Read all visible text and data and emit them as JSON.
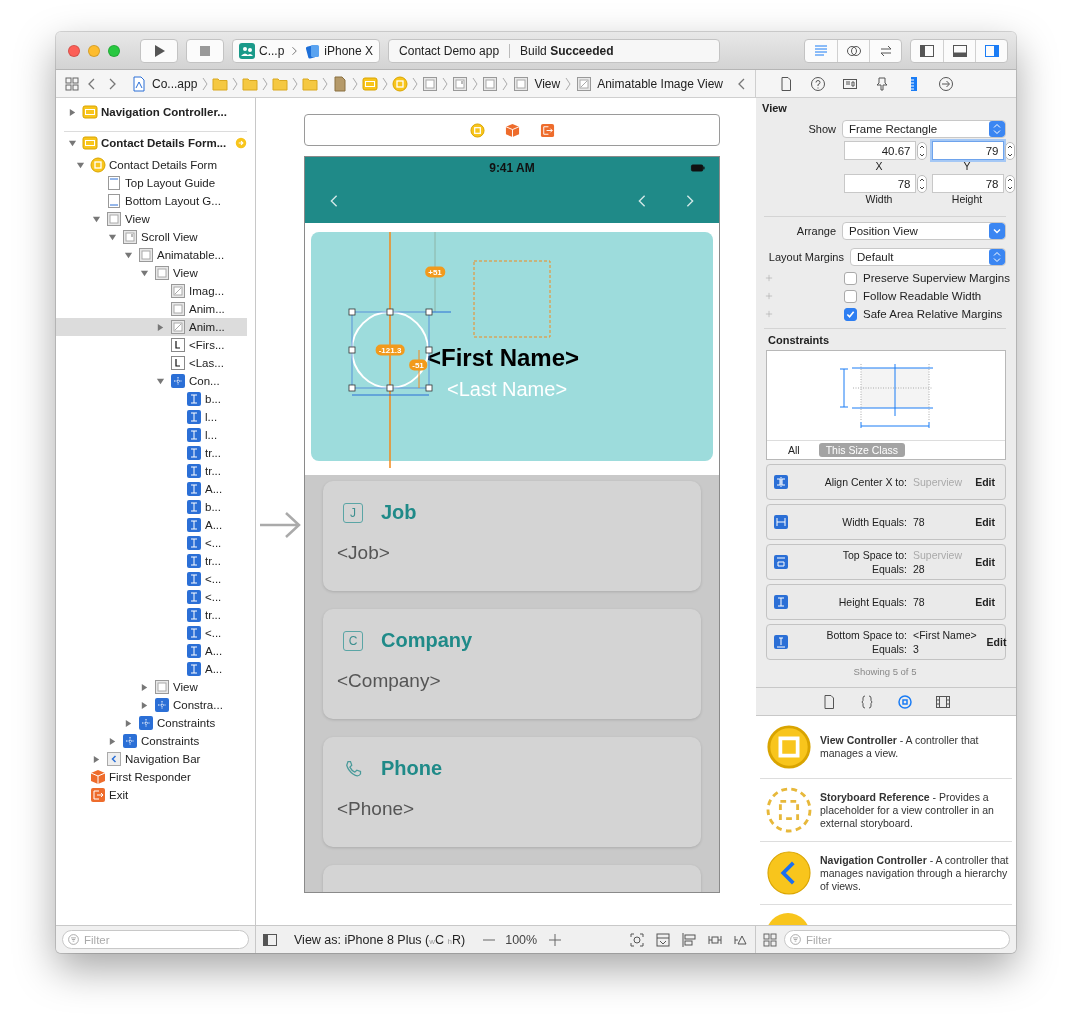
{
  "toolbar": {
    "scheme": {
      "target": "C...p",
      "destination": "iPhone X"
    },
    "activity": {
      "project": "Contact Demo app",
      "status": "Build **Succeeded**"
    },
    "editor_modes": [
      {
        "kind": "editor-standard",
        "selected": true
      },
      {
        "kind": "editor-assistant",
        "selected": false
      },
      {
        "kind": "editor-version",
        "selected": false
      }
    ],
    "panels": [
      {
        "kind": "panel-left",
        "on": false
      },
      {
        "kind": "panel-bottom",
        "on": false
      },
      {
        "kind": "panel-right",
        "on": true
      }
    ]
  },
  "jump_bar": {
    "crumbs": [
      {
        "kind": "project-file",
        "label": "Co...app"
      },
      {
        "kind": "folder"
      },
      {
        "kind": "folder"
      },
      {
        "kind": "folder"
      },
      {
        "kind": "folder"
      },
      {
        "kind": "storyboard-file"
      },
      {
        "kind": "scene"
      },
      {
        "kind": "view-controller"
      },
      {
        "kind": "view"
      },
      {
        "kind": "scroll"
      },
      {
        "kind": "view"
      },
      {
        "kind": "view",
        "label": "View"
      },
      {
        "kind": "image",
        "label": "Animatable Image View"
      }
    ]
  },
  "navigator": {
    "tree": [
      {
        "label": "Navigation Controller...",
        "kind": "scene",
        "expanded": false,
        "selected": false,
        "initial": false
      },
      {
        "label": "Contact Details Form...",
        "kind": "scene",
        "expanded": true,
        "selected": false,
        "initial": true,
        "children": [
          {
            "label": "Contact Details Form",
            "kind": "view-controller",
            "expanded": true,
            "selected": false,
            "children": [
              {
                "label": "Top Layout Guide",
                "kind": "guide-top",
                "selected": false
              },
              {
                "label": "Bottom Layout G...",
                "kind": "guide-bottom",
                "selected": false
              },
              {
                "label": "View",
                "kind": "view",
                "expanded": true,
                "selected": false,
                "children": [
                  {
                    "label": "Scroll View",
                    "kind": "scroll",
                    "expanded": true,
                    "selected": false,
                    "children": [
                      {
                        "label": "Animatable...",
                        "kind": "view",
                        "expanded": true,
                        "selected": false,
                        "children": [
                          {
                            "label": "View",
                            "kind": "view",
                            "expanded": true,
                            "selected": false,
                            "children": [
                              {
                                "label": "Imag...",
                                "kind": "image",
                                "selected": false
                              },
                              {
                                "label": "Anim...",
                                "kind": "view",
                                "selected": false
                              },
                              {
                                "label": "Anim...",
                                "kind": "image",
                                "expanded": false,
                                "selected": true
                              },
                              {
                                "label": "<Firs...",
                                "kind": "label",
                                "selected": false
                              },
                              {
                                "label": "<Las...",
                                "kind": "label",
                                "selected": false
                              },
                              {
                                "label": "Con...",
                                "kind": "constraints",
                                "expanded": true,
                                "selected": false,
                                "children": [
                                  {
                                    "label": "b...",
                                    "kind": "constraint",
                                    "selected": false
                                  },
                                  {
                                    "label": "l...",
                                    "kind": "constraint",
                                    "selected": false
                                  },
                                  {
                                    "label": "l...",
                                    "kind": "constraint",
                                    "selected": false
                                  },
                                  {
                                    "label": "tr...",
                                    "kind": "constraint",
                                    "selected": false
                                  },
                                  {
                                    "label": "tr...",
                                    "kind": "constraint",
                                    "selected": false
                                  },
                                  {
                                    "label": "A...",
                                    "kind": "constraint",
                                    "selected": false
                                  },
                                  {
                                    "label": "b...",
                                    "kind": "constraint",
                                    "selected": false
                                  },
                                  {
                                    "label": "A...",
                                    "kind": "constraint",
                                    "selected": false
                                  },
                                  {
                                    "label": "<...",
                                    "kind": "constraint",
                                    "selected": false
                                  },
                                  {
                                    "label": "tr...",
                                    "kind": "constraint",
                                    "selected": false
                                  },
                                  {
                                    "label": "<...",
                                    "kind": "constraint",
                                    "selected": false
                                  },
                                  {
                                    "label": "<...",
                                    "kind": "constraint",
                                    "selected": false
                                  },
                                  {
                                    "label": "tr...",
                                    "kind": "constraint",
                                    "selected": false
                                  },
                                  {
                                    "label": "<...",
                                    "kind": "constraint",
                                    "selected": false
                                  },
                                  {
                                    "label": "A...",
                                    "kind": "constraint",
                                    "selected": false
                                  },
                                  {
                                    "label": "A...",
                                    "kind": "constraint",
                                    "selected": false
                                  }
                                ]
                              }
                            ]
                          },
                          {
                            "label": "View",
                            "kind": "view",
                            "expanded": false,
                            "selected": false
                          },
                          {
                            "label": "Constra...",
                            "kind": "constraints",
                            "expanded": false,
                            "selected": false
                          }
                        ]
                      },
                      {
                        "label": "Constraints",
                        "kind": "constraints",
                        "expanded": false,
                        "selected": false
                      }
                    ]
                  },
                  {
                    "label": "Constraints",
                    "kind": "constraints",
                    "expanded": false,
                    "selected": false
                  }
                ]
              },
              {
                "label": "Navigation Bar",
                "kind": "navbar",
                "expanded": false,
                "selected": false
              }
            ]
          },
          {
            "label": "First Responder",
            "kind": "first-responder",
            "selected": false
          },
          {
            "label": "Exit",
            "kind": "exit",
            "selected": false
          }
        ]
      }
    ],
    "filter": {
      "placeholder": "Filter"
    }
  },
  "canvas": {
    "scene_dock": [
      {
        "kind": "view-controller"
      },
      {
        "kind": "first-responder"
      },
      {
        "kind": "exit"
      }
    ],
    "status_time": "9:41 AM",
    "header": {
      "first_name": "<First Name>",
      "last_name": "<Last Name>",
      "badges": [
        "+51",
        "-121.3",
        "-51"
      ]
    },
    "cards": [
      {
        "kind": "letter",
        "letter": "J",
        "title": "Job",
        "value": "<Job>"
      },
      {
        "kind": "letter",
        "letter": "C",
        "title": "Company",
        "value": "<Company>"
      },
      {
        "kind": "phone",
        "title": "Phone",
        "value": "<Phone>"
      }
    ]
  },
  "inspector": {
    "tabs": [
      {
        "kind": "file",
        "selected": false
      },
      {
        "kind": "help",
        "selected": false
      },
      {
        "kind": "identity",
        "selected": false
      },
      {
        "kind": "attributes",
        "selected": false
      },
      {
        "kind": "size",
        "selected": true
      },
      {
        "kind": "connections",
        "selected": false
      }
    ],
    "section": "View",
    "show": {
      "label": "Show",
      "value": "Frame Rectangle",
      "kind": "popup"
    },
    "frame_fields": [
      {
        "label": "X",
        "value": "40.67",
        "focused": false
      },
      {
        "label": "Y",
        "value": "79",
        "focused": true
      },
      {
        "label": "Width",
        "value": "78",
        "focused": false
      },
      {
        "label": "Height",
        "value": "78",
        "focused": false
      }
    ],
    "arrange": {
      "label": "Arrange",
      "value": "Position View",
      "kind": "pulldown"
    },
    "layout_margins": {
      "label": "Layout Margins",
      "value": "Default",
      "kind": "popup"
    },
    "options": [
      {
        "label": "Preserve Superview Margins",
        "checked": false
      },
      {
        "label": "Follow Readable Width",
        "checked": false
      },
      {
        "label": "Safe Area Relative Margins",
        "checked": true
      }
    ],
    "constraints_title": "Constraints",
    "size_class_filter": [
      {
        "label": "All",
        "selected": false
      },
      {
        "label": "This Size Class",
        "selected": true
      }
    ],
    "constraints": [
      {
        "kind": "center-x",
        "lines": [
          {
            "label": "Align Center X to:",
            "value": "Superview",
            "muted": true
          }
        ],
        "action": "Edit"
      },
      {
        "kind": "width",
        "lines": [
          {
            "label": "Width Equals:",
            "value": "78",
            "muted": false
          }
        ],
        "action": "Edit"
      },
      {
        "kind": "top",
        "lines": [
          {
            "label": "Top Space to:",
            "value": "Superview",
            "muted": true
          },
          {
            "label": "Equals:",
            "value": "28",
            "muted": false
          }
        ],
        "action": "Edit"
      },
      {
        "kind": "height",
        "lines": [
          {
            "label": "Height Equals:",
            "value": "78",
            "muted": false
          }
        ],
        "action": "Edit"
      },
      {
        "kind": "bottom",
        "lines": [
          {
            "label": "Bottom Space to:",
            "value": "<First Name>",
            "muted": false
          },
          {
            "label": "Equals:",
            "value": "3",
            "muted": false
          }
        ],
        "action": "Edit"
      }
    ],
    "summary": "Showing 5 of 5"
  },
  "library": {
    "tabs": [
      {
        "kind": "file",
        "selected": false
      },
      {
        "kind": "braces",
        "selected": false
      },
      {
        "kind": "object",
        "selected": true
      },
      {
        "kind": "media",
        "selected": false
      }
    ],
    "items": [
      {
        "kind": "view-controller",
        "text": "**View Controller** - A controller that manages a view."
      },
      {
        "kind": "storyboard-reference",
        "text": "**Storyboard Reference** - Provides a placeholder for a view controller in an external storyboard."
      },
      {
        "kind": "navigation-controller",
        "text": "**Navigation Controller** - A controller that manages navigation through a hierarchy of views."
      }
    ],
    "filter": {
      "placeholder": "Filter"
    }
  },
  "bottom_bar": {
    "view_as": {
      "text": "View as: iPhone 8 Plus (",
      "size_classes": [
        {
          "prefix": "w",
          "value": "C"
        },
        {
          "prefix": "h",
          "value": "R"
        }
      ],
      "end": ")"
    },
    "zoom": "100%",
    "tools": [
      {
        "kind": "update-frames"
      },
      {
        "kind": "embed"
      },
      {
        "kind": "align"
      },
      {
        "kind": "pin"
      },
      {
        "kind": "resolve"
      }
    ]
  }
}
